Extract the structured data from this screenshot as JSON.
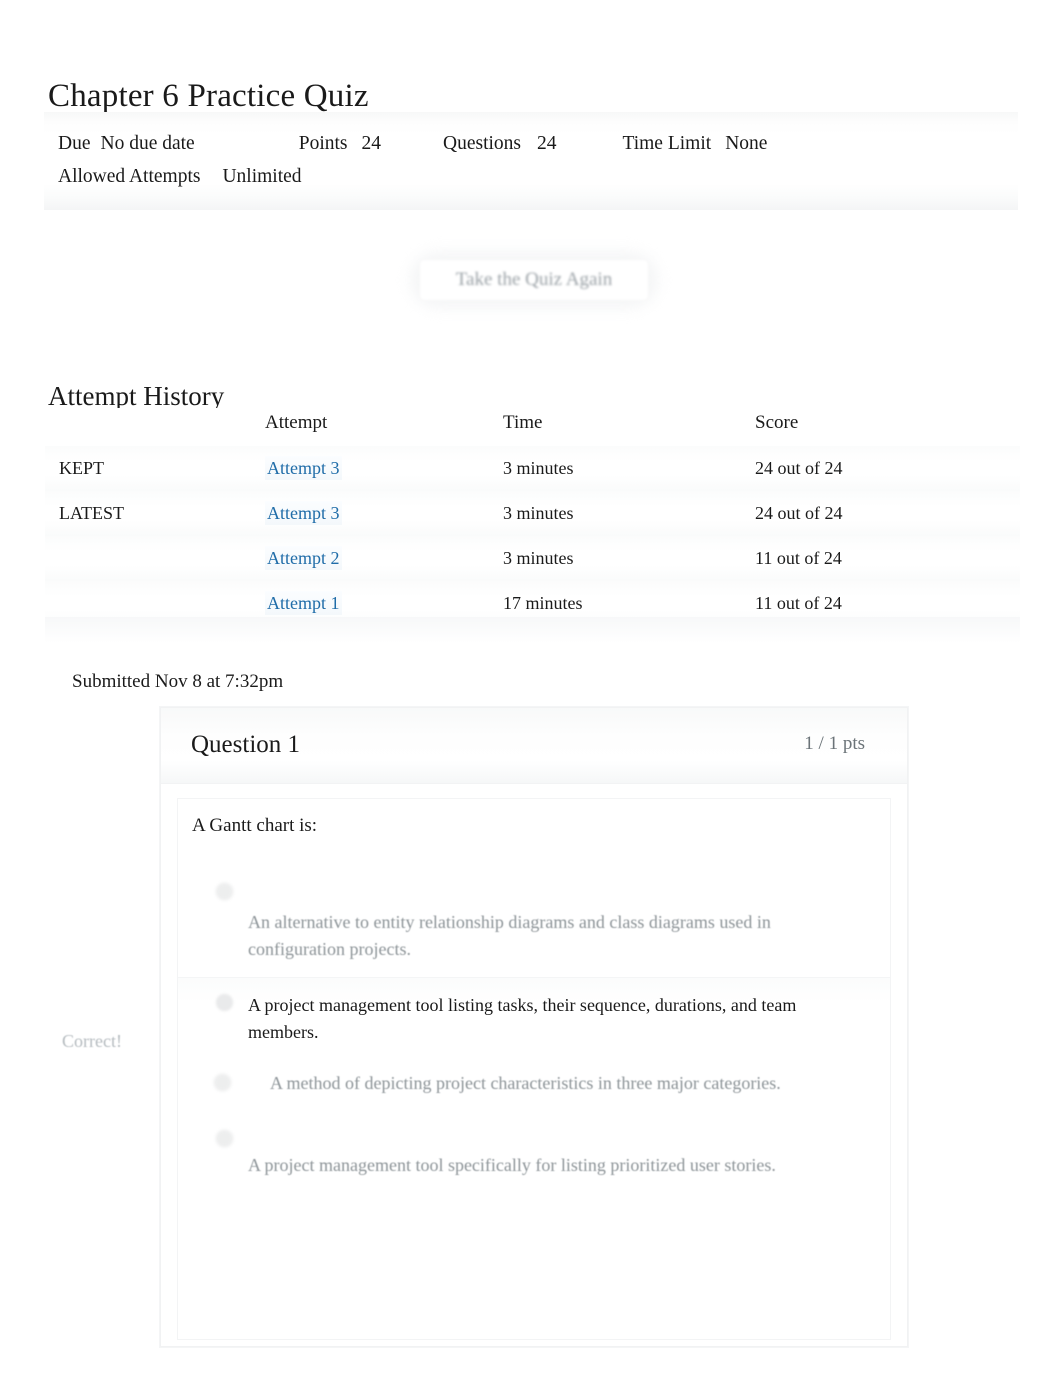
{
  "quiz": {
    "title": "Chapter 6 Practice Quiz",
    "meta": {
      "due_label": "Due",
      "due_value": "No due date",
      "points_label": "Points",
      "points_value": "24",
      "questions_label": "Questions",
      "questions_value": "24",
      "time_limit_label": "Time Limit",
      "time_limit_value": "None",
      "allowed_attempts_label": "Allowed Attempts",
      "allowed_attempts_value": "Unlimited"
    },
    "retake_button_label": "Take the Quiz Again"
  },
  "attempt_history": {
    "heading": "Attempt History",
    "columns": [
      "",
      "Attempt",
      "Time",
      "Score"
    ],
    "rows": [
      {
        "tag": "KEPT",
        "attempt": "Attempt 3",
        "time": "3 minutes",
        "score": "24 out of 24"
      },
      {
        "tag": "LATEST",
        "attempt": "Attempt 3",
        "time": "3 minutes",
        "score": "24 out of 24"
      },
      {
        "tag": "",
        "attempt": "Attempt 2",
        "time": "3 minutes",
        "score": "11 out of 24"
      },
      {
        "tag": "",
        "attempt": "Attempt 1",
        "time": "17 minutes",
        "score": "11 out of 24"
      }
    ]
  },
  "submission": {
    "submitted_text": "Submitted Nov 8 at 7:32pm"
  },
  "question": {
    "name": "Question 1",
    "points": "1 / 1 pts",
    "prompt": "A Gantt chart is:",
    "correct_flag": "Correct!",
    "answers": [
      {
        "text": "An alternative to entity relationship diagrams and class diagrams used in configuration projects.",
        "selected": false
      },
      {
        "text": "A project management tool listing tasks, their sequence, durations, and team members.",
        "selected": true
      },
      {
        "text": "A method of depicting project characteristics in three major categories.",
        "selected": false
      },
      {
        "text": "A project management tool specifically for listing prioritized user stories.",
        "selected": false
      }
    ]
  },
  "colors": {
    "link": "#1f6ca8",
    "text": "#1a1a1a",
    "muted": "#8d9498",
    "flag": "#b6bcc0"
  }
}
